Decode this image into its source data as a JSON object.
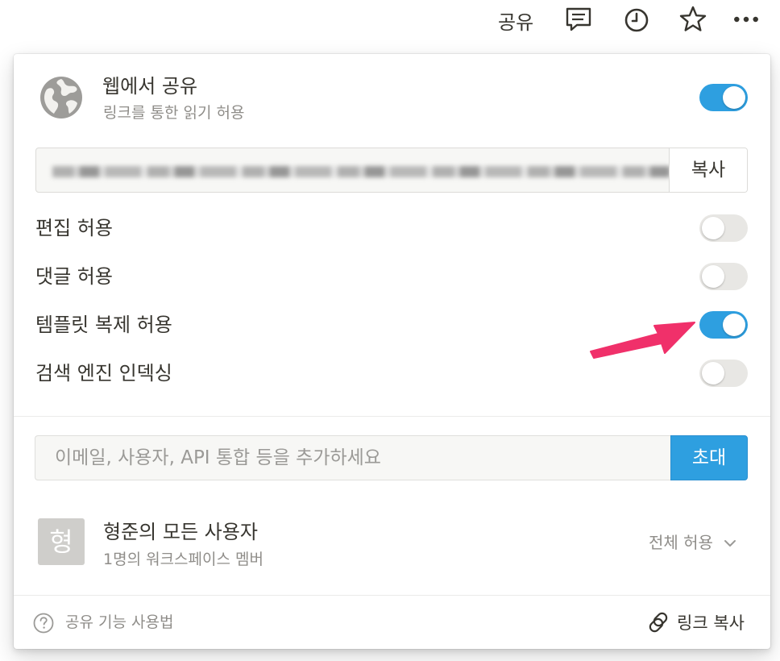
{
  "topbar": {
    "share_label": "공유",
    "icons": [
      "comment-icon",
      "history-icon",
      "star-icon",
      "more-icon"
    ]
  },
  "share_panel": {
    "web": {
      "title": "웹에서 공유",
      "subtitle": "링크를 통한 읽기 허용",
      "enabled": true,
      "icon": "globe-icon"
    },
    "link": {
      "copy_label": "복사"
    },
    "options": [
      {
        "label": "편집 허용",
        "enabled": false
      },
      {
        "label": "댓글 허용",
        "enabled": false
      },
      {
        "label": "템플릿 복제 허용",
        "enabled": true
      },
      {
        "label": "검색 엔진 인덱싱",
        "enabled": false
      }
    ],
    "invite": {
      "placeholder": "이메일, 사용자, API 통합 등을 추가하세요",
      "button_label": "초대"
    },
    "workspace": {
      "avatar_text": "형",
      "name": "형준의 모든 사용자",
      "members": "1명의 워크스페이스 멤버",
      "permission": "전체 허용",
      "permission_icon": "chevron-down-icon"
    },
    "footer": {
      "help_label": "공유 기능 사용법",
      "copy_link_label": "링크 복사"
    }
  },
  "annotation": {
    "arrow_color": "#f0306a"
  },
  "colors": {
    "accent": "#2e9fe0",
    "toggle_off": "#e8e7e4",
    "text": "#37352f",
    "muted": "#8f8d89"
  }
}
